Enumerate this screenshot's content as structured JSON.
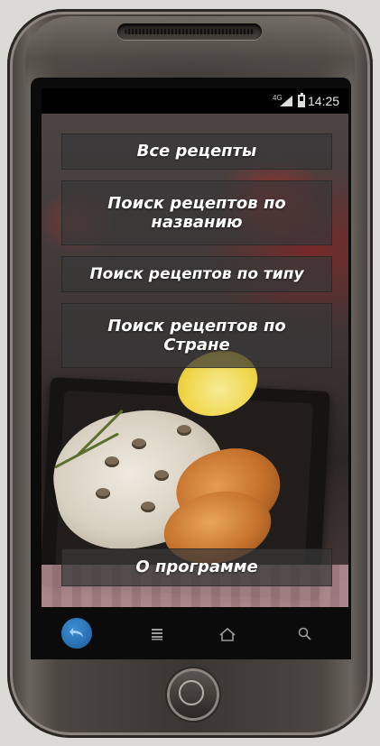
{
  "statusbar": {
    "network": "4G",
    "time": "14:25"
  },
  "menu": {
    "all_recipes": "Все рецепты",
    "search_by_name": "Поиск рецептов по названию",
    "search_by_type": "Поиск рецептов по типу",
    "search_by_country": "Поиск рецептов по Стране",
    "about": "О программе"
  },
  "navbar": {
    "icons": [
      "back-icon",
      "menu-icon",
      "home-icon",
      "search-icon"
    ]
  },
  "colors": {
    "button_bg": "#373737",
    "button_text": "#ffffff",
    "back_button": "#2f7fc4",
    "statusbar_bg": "#000000"
  }
}
